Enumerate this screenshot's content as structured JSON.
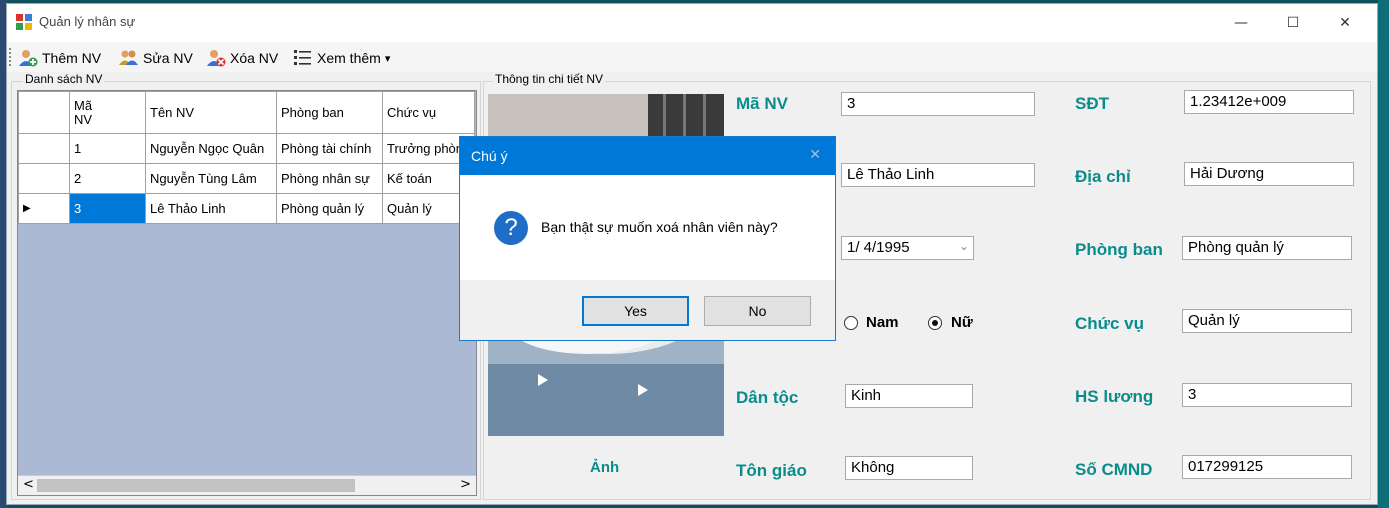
{
  "window": {
    "title": "Quản lý nhân sự",
    "controls": {
      "minimize": "—",
      "maximize": "☐",
      "close": "✕"
    }
  },
  "toolbar": {
    "add_label": "Thêm NV",
    "edit_label": "Sửa NV",
    "delete_label": "Xóa NV",
    "more_label": "Xem thêm",
    "more_arrow": "▾"
  },
  "list_group": {
    "title": "Danh sách NV"
  },
  "grid": {
    "columns": [
      "Mã\nNV",
      "Tên NV",
      "Phòng ban",
      "Chức vụ"
    ],
    "rows": [
      {
        "marker": "",
        "ma": "1",
        "ten": "Nguyễn Ngọc Quân",
        "phong": "Phòng tài chính",
        "chucvu": "Trưởng phòng"
      },
      {
        "marker": "",
        "ma": "2",
        "ten": "Nguyễn Tùng Lâm",
        "phong": "Phòng nhân sự",
        "chucvu": "Kế toán"
      },
      {
        "marker": "▶",
        "ma": "3",
        "ten": "Lê Thảo Linh",
        "phong": "Phòng quản lý",
        "chucvu": "Quản lý"
      }
    ],
    "scroll_left": "<",
    "scroll_right": ">"
  },
  "detail_group": {
    "title": "Thông tin chi tiết NV"
  },
  "detail": {
    "ma_nv_label": "Mã NV",
    "ma_nv_value": "3",
    "ten_value": "Lê Thảo Linh",
    "ngay_sinh_value": "1/  4/1995",
    "gioi_tinh_nam": "Nam",
    "gioi_tinh_nu": "Nữ",
    "dan_toc_label": "Dân tộc",
    "dan_toc_value": "Kinh",
    "ton_giao_label": "Tôn giáo",
    "ton_giao_value": "Không",
    "anh_label": "Ảnh",
    "sdt_label": "SĐT",
    "sdt_value": "1.23412e+009",
    "dia_chi_label": "Địa chỉ",
    "dia_chi_value": "Hải Dương",
    "phong_ban_label": "Phòng ban",
    "phong_ban_value": "Phòng quản lý",
    "chuc_vu_label": "Chức vụ",
    "chuc_vu_value": "Quản lý",
    "hs_luong_label": "HS lương",
    "hs_luong_value": "3",
    "so_cmnd_label": "Số CMND",
    "so_cmnd_value": "017299125"
  },
  "dialog": {
    "title": "Chú ý",
    "message": "Bạn thật sự muốn xoá nhân viên này?",
    "yes_label": "Yes",
    "no_label": "No",
    "close_glyph": "✕",
    "icon_glyph": "?"
  },
  "colors": {
    "accent": "#0078d7",
    "label_teal": "#0b8c8c",
    "grid_bg": "#abb9d4"
  }
}
